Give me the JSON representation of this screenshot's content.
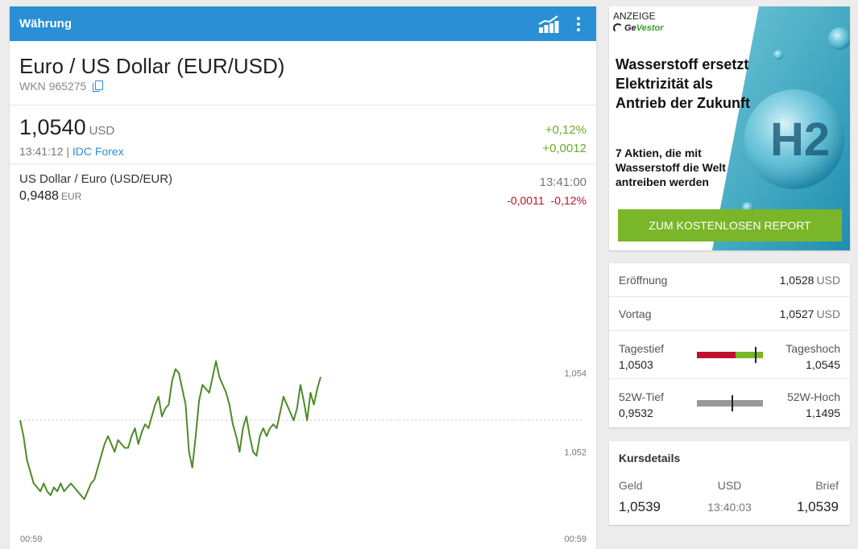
{
  "header": {
    "title": "Währung",
    "chart_icon": "chart-icon",
    "menu_icon": "more-vert-icon",
    "bg_color": "#2a8fd4"
  },
  "instrument": {
    "name": "Euro / US Dollar (EUR/USD)",
    "wkn": "WKN 965275"
  },
  "price": {
    "value": "1,0540",
    "unit": "USD",
    "time": "13:41:12 |",
    "source": "IDC Forex",
    "change_pct": "+0,12%",
    "change_abs": "+0,0012",
    "positive_color": "#6aab2a"
  },
  "inverse": {
    "title": "US Dollar / Euro (USD/EUR)",
    "value": "0,9488",
    "unit": "EUR",
    "time": "13:41:00",
    "change_abs": "-0,0011",
    "change_pct": "-0,12%",
    "negative_color": "#c0102a"
  },
  "chart_data": {
    "type": "line",
    "x_labels": [
      "00:59",
      "00:59"
    ],
    "y_ticks": [
      {
        "value": 1.054,
        "label": "1,054"
      },
      {
        "value": 1.052,
        "label": "1,052"
      }
    ],
    "reference_value": 1.0528,
    "ylim": [
      1.0507,
      1.0565
    ],
    "color": "#4e8a2a",
    "values": [
      1.0528,
      1.0524,
      1.0518,
      1.0515,
      1.0512,
      1.0511,
      1.051,
      1.0512,
      1.051,
      1.0509,
      1.0511,
      1.051,
      1.0512,
      1.051,
      1.0511,
      1.0512,
      1.0511,
      1.051,
      1.0509,
      1.0508,
      1.051,
      1.0512,
      1.0513,
      1.0516,
      1.0519,
      1.0522,
      1.0524,
      1.0522,
      1.052,
      1.0523,
      1.0522,
      1.0521,
      1.0521,
      1.0524,
      1.0526,
      1.0522,
      1.0525,
      1.0527,
      1.0526,
      1.0529,
      1.0532,
      1.0534,
      1.0529,
      1.0531,
      1.0532,
      1.0538,
      1.0541,
      1.054,
      1.0536,
      1.0532,
      1.052,
      1.0516,
      1.0524,
      1.0533,
      1.0537,
      1.0536,
      1.0535,
      1.0539,
      1.0543,
      1.0539,
      1.0537,
      1.0535,
      1.0532,
      1.0527,
      1.0524,
      1.052,
      1.0526,
      1.0529,
      1.0524,
      1.052,
      1.0519,
      1.0524,
      1.0526,
      1.0524,
      1.0526,
      1.0527,
      1.0526,
      1.053,
      1.0534,
      1.0532,
      1.053,
      1.0528,
      1.0531,
      1.0537,
      1.0533,
      1.0528,
      1.0535,
      1.0532,
      1.0536,
      1.0539
    ]
  },
  "ad": {
    "label": "ANZEIGE",
    "brand_prefix": "Ge",
    "brand_suffix": "Vestor",
    "headline": "Wasserstoff ersetzt Elektrizität als Antrieb der Zukunft",
    "subline": "7 Aktien, die mit Wasserstoff die Welt antreiben werden",
    "button": "ZUM KOSTENLOSEN REPORT",
    "button_color": "#7ab629",
    "image_text": "H2"
  },
  "stats": {
    "rows": [
      {
        "label": "Eröffnung",
        "value": "1,0528",
        "unit": "USD"
      },
      {
        "label": "Vortag",
        "value": "1,0527",
        "unit": "USD"
      }
    ],
    "day_range": {
      "low_label": "Tagestief",
      "low": "1,0503",
      "high_label": "Tageshoch",
      "high": "1,0545",
      "position": 0.88,
      "low_color": "#c0102a",
      "high_color": "#7ab629"
    },
    "year_range": {
      "low_label": "52W-Tief",
      "low": "0,9532",
      "high_label": "52W-Hoch",
      "high": "1,1495",
      "position": 0.52,
      "bar_color": "#999999"
    }
  },
  "details": {
    "title": "Kursdetails",
    "bid_label": "Geld",
    "currency_label": "USD",
    "ask_label": "Brief",
    "bid": "1,0539",
    "time": "13:40:03",
    "ask": "1,0539"
  }
}
